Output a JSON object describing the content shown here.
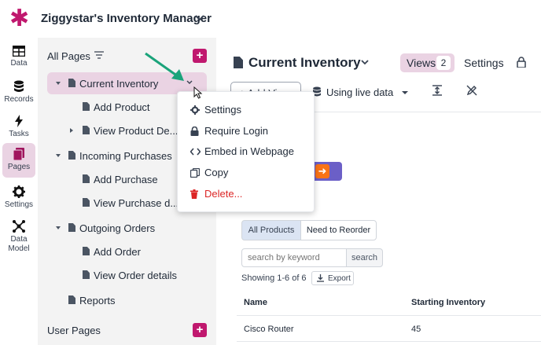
{
  "app": {
    "title": "Ziggystar's Inventory Manager",
    "brand_color": "#c0186e"
  },
  "rail": {
    "items": [
      {
        "label": "Data",
        "icon": "table-icon"
      },
      {
        "label": "Records",
        "icon": "database-icon"
      },
      {
        "label": "Tasks",
        "icon": "bolt-icon"
      },
      {
        "label": "Pages",
        "icon": "pages-icon",
        "active": true
      },
      {
        "label": "Settings",
        "icon": "gear-icon"
      },
      {
        "label_line1": "Data",
        "label_line2": "Model",
        "icon": "network-icon"
      }
    ]
  },
  "pages_panel": {
    "heading": "All Pages",
    "user_pages_heading": "User Pages",
    "tree": [
      {
        "label": "Current Inventory",
        "active": true
      },
      {
        "label": "Add Product"
      },
      {
        "label": "View Product De..."
      },
      {
        "label": "Incoming Purchases"
      },
      {
        "label": "Add Purchase"
      },
      {
        "label": "View Purchase d..."
      },
      {
        "label": "Outgoing Orders"
      },
      {
        "label": "Add Order"
      },
      {
        "label": "View Order details"
      },
      {
        "label": "Reports"
      }
    ]
  },
  "main": {
    "page_title": "Current Inventory",
    "views_label": "Views",
    "views_count": "2",
    "settings_label": "Settings",
    "add_view_label": "+ Add View",
    "live_data_label": "Using live data",
    "filters": [
      "All Products",
      "Need to Reorder"
    ],
    "search_placeholder": "search by keyword",
    "search_button": "search",
    "showing": "Showing 1-6 of 6",
    "export_label": "Export",
    "table": {
      "headers": [
        "Name",
        "Starting Inventory"
      ],
      "rows": [
        [
          "Cisco Router",
          "45"
        ]
      ]
    }
  },
  "menu": {
    "items": [
      {
        "label": "Settings",
        "icon": "gear-icon"
      },
      {
        "label": "Require Login",
        "icon": "lock-icon"
      },
      {
        "label": "Embed in Webpage",
        "icon": "code-icon"
      },
      {
        "label": "Copy",
        "icon": "copy-icon"
      },
      {
        "label": "Delete...",
        "icon": "trash-icon",
        "danger_color": "#dc2626"
      }
    ]
  }
}
